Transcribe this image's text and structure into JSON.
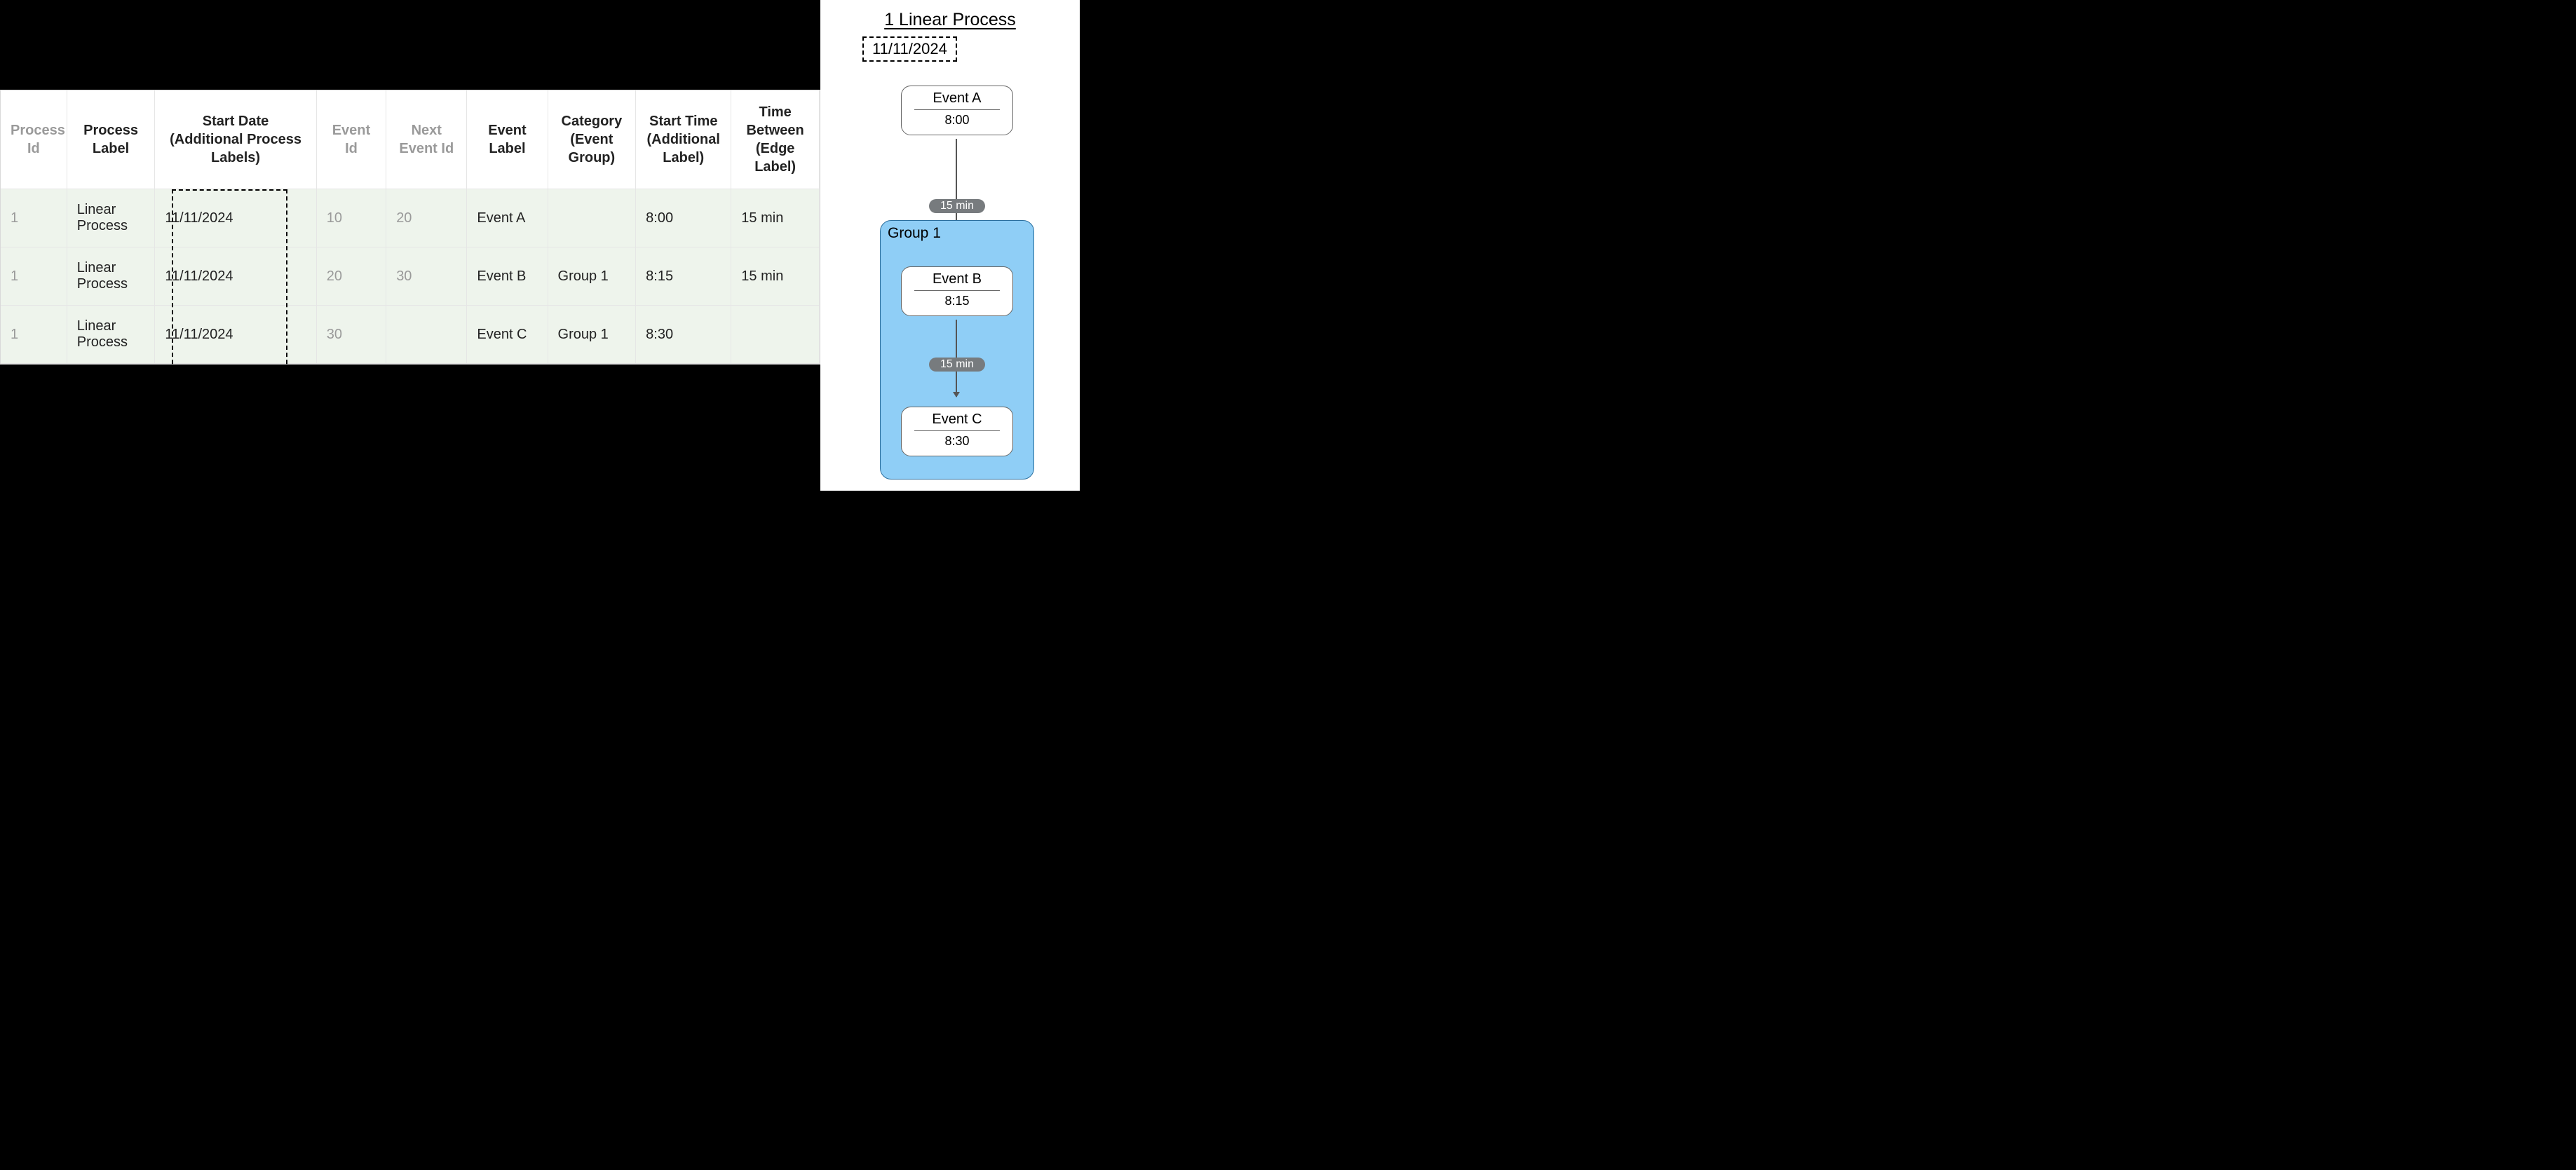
{
  "table": {
    "headers": {
      "process_id": "Process Id",
      "process_label": "Process Label",
      "start_date": "Start Date (Additional Process Labels)",
      "event_id": "Event Id",
      "next_event_id": "Next Event Id",
      "event_label": "Event Label",
      "category": "Category (Event Group)",
      "start_time": "Start Time (Additional Label)",
      "time_between": "Time Between (Edge Label)"
    },
    "rows": [
      {
        "process_id": "1",
        "process_label": "Linear Process",
        "start_date": "11/11/2024",
        "event_id": "10",
        "next_event_id": "20",
        "event_label": "Event A",
        "category": "",
        "start_time": "8:00",
        "time_between": "15 min"
      },
      {
        "process_id": "1",
        "process_label": "Linear Process",
        "start_date": "11/11/2024",
        "event_id": "20",
        "next_event_id": "30",
        "event_label": "Event B",
        "category": "Group 1",
        "start_time": "8:15",
        "time_between": "15 min"
      },
      {
        "process_id": "1",
        "process_label": "Linear Process",
        "start_date": "11/11/2024",
        "event_id": "30",
        "next_event_id": "",
        "event_label": "Event C",
        "category": "Group 1",
        "start_time": "8:30",
        "time_between": ""
      }
    ]
  },
  "diagram": {
    "title": "1 Linear Process",
    "subtitle": "11/11/2024",
    "group_label": "Group 1",
    "nodes": {
      "a": {
        "label": "Event A",
        "time": "8:00"
      },
      "b": {
        "label": "Event B",
        "time": "8:15"
      },
      "c": {
        "label": "Event C",
        "time": "8:30"
      }
    },
    "edges": {
      "ab": "15 min",
      "bc": "15 min"
    }
  }
}
